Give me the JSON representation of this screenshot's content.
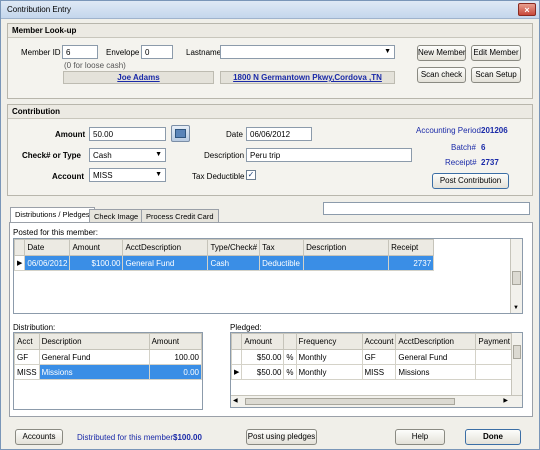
{
  "window": {
    "title": "Contribution Entry"
  },
  "lookup": {
    "header": "Member Look-up",
    "member_id_label": "Member ID",
    "member_id_value": "6",
    "envelope_label": "Envelope",
    "envelope_value": "0",
    "envelope_hint": "(0 for loose cash)",
    "lastname_label": "Lastname",
    "lastname_value": "",
    "member_name": "Joe Adams",
    "member_address": "1800 N Germantown Pkwy,Cordova ,TN",
    "btn_new_member": "New Member",
    "btn_edit_member": "Edit Member",
    "btn_scan_check": "Scan check",
    "btn_scan_setup": "Scan Setup"
  },
  "contribution": {
    "header": "Contribution",
    "amount_label": "Amount",
    "amount_value": "50.00",
    "check_label": "Check# or Type",
    "check_value": "Cash",
    "account_label": "Account",
    "account_value": "MISS",
    "date_label": "Date",
    "date_value": "06/06/2012",
    "description_label": "Description",
    "description_value": "Peru trip",
    "tax_label": "Tax Deductible",
    "tax_checked": "✓",
    "period_label": "Accounting Period",
    "period_value": "201206",
    "batch_label": "Batch#",
    "batch_value": "6",
    "receipt_label": "Receipt#",
    "receipt_value": "2737",
    "btn_post": "Post Contribution"
  },
  "tabs": [
    "Distributions / Pledges",
    "Check Image",
    "Process Credit Card"
  ],
  "posted": {
    "label": "Posted for this member:",
    "columns": [
      "Date",
      "Amount",
      "AcctDescription",
      "Type/Check#",
      "Tax",
      "Description",
      "Receipt"
    ],
    "rows": [
      [
        "06/06/2012",
        "$100.00",
        "General Fund",
        "Cash",
        "Deductible",
        "",
        "2737"
      ]
    ]
  },
  "distribution": {
    "label": "Distribution:",
    "columns": [
      "Acct",
      "Description",
      "Amount"
    ],
    "rows": [
      [
        "GF",
        "General Fund",
        "100.00"
      ],
      [
        "MISS",
        "Missions",
        "0.00"
      ]
    ]
  },
  "pledged": {
    "label": "Pledged:",
    "columns": [
      "Amount",
      "",
      "Frequency",
      "Account",
      "AcctDescription",
      "Payment"
    ],
    "rows": [
      [
        "$50.00",
        "%",
        "Monthly",
        "GF",
        "General Fund",
        ""
      ],
      [
        "$50.00",
        "%",
        "Monthly",
        "MISS",
        "Missions",
        ""
      ]
    ]
  },
  "footer": {
    "btn_accounts": "Accounts",
    "distributed_label": "Distributed for this member:",
    "distributed_value": "$100.00",
    "btn_post_pledges": "Post using pledges",
    "btn_help": "Help",
    "btn_done": "Done"
  },
  "colors": {
    "selection": "#3a8ee6",
    "link": "#1a2aa8",
    "titlebar": "#c4d6ec"
  }
}
